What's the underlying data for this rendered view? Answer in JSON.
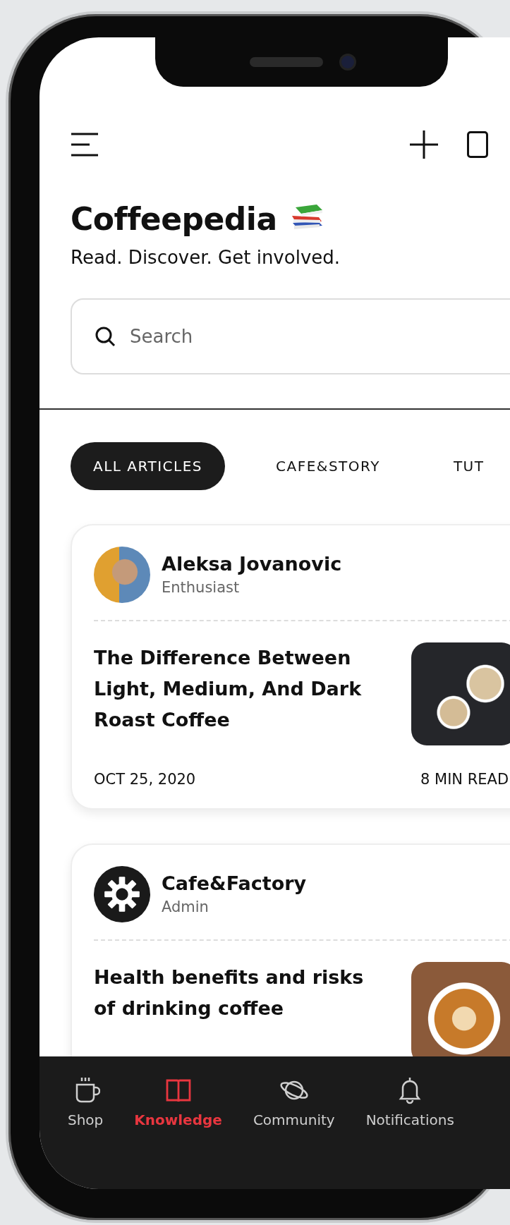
{
  "header": {
    "title": "Coffeepedia",
    "subtitle": "Read. Discover. Get involved."
  },
  "search": {
    "placeholder": "Search"
  },
  "tabs": [
    {
      "label": "ALL ARTICLES",
      "selected": true
    },
    {
      "label": "CAFE&STORY",
      "selected": false
    },
    {
      "label": "TUT",
      "selected": false
    }
  ],
  "articles": [
    {
      "author": "Aleksa Jovanovic",
      "role": "Enthusiast",
      "title": "The Difference Between Light, Medium, And Dark Roast Coffee",
      "date": "OCT 25, 2020",
      "read_time": "8 MIN READ"
    },
    {
      "author": "Cafe&Factory",
      "role": "Admin",
      "title": "Health benefits and risks of drinking coffee"
    }
  ],
  "nav": [
    {
      "label": "Shop",
      "selected": false
    },
    {
      "label": "Knowledge",
      "selected": true
    },
    {
      "label": "Community",
      "selected": false
    },
    {
      "label": "Notifications",
      "selected": false
    }
  ]
}
